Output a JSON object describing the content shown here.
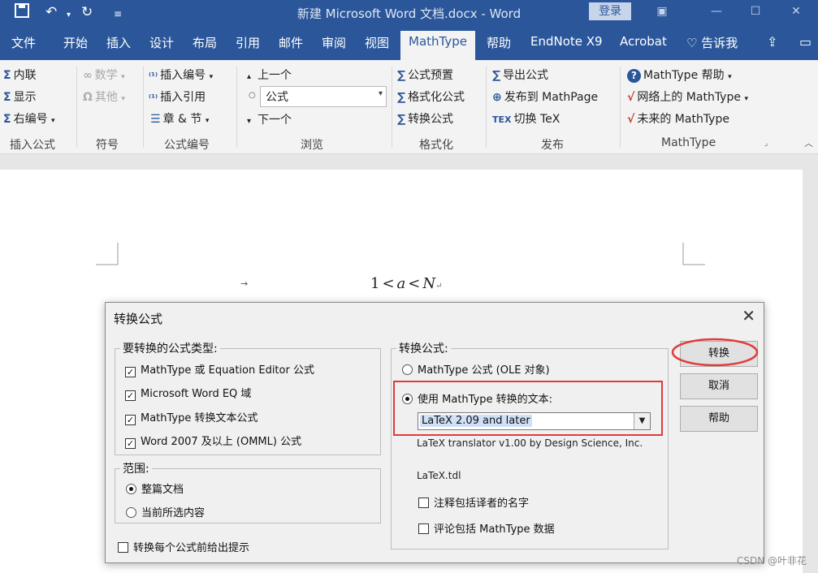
{
  "window": {
    "title": "新建 Microsoft Word 文档.docx  -  Word",
    "login": "登录",
    "qa_icons": [
      "save-icon",
      "undo-icon",
      "redo-icon",
      "customize-icon"
    ],
    "win_controls": [
      "ribbon-display-icon",
      "minimize-icon",
      "maximize-icon",
      "close-icon"
    ]
  },
  "tabs": [
    {
      "label": "文件"
    },
    {
      "label": "开始"
    },
    {
      "label": "插入"
    },
    {
      "label": "设计"
    },
    {
      "label": "布局"
    },
    {
      "label": "引用"
    },
    {
      "label": "邮件"
    },
    {
      "label": "审阅"
    },
    {
      "label": "视图"
    },
    {
      "label": "MathType"
    },
    {
      "label": "帮助"
    },
    {
      "label": "EndNote X9"
    },
    {
      "label": "Acrobat"
    },
    {
      "label": "告诉我"
    }
  ],
  "ribbon": {
    "insert_formula": {
      "inline": "内联",
      "display": "显示",
      "right_numbered": "右编号",
      "label": "插入公式"
    },
    "symbols": {
      "math": "数学",
      "other": "其他",
      "label": "符号"
    },
    "numbering": {
      "insert_number": "插入编号",
      "insert_ref": "插入引用",
      "chapter": "章 & 节",
      "label": "公式编号"
    },
    "browse": {
      "prev": "上一个",
      "combo_value": "公式",
      "next": "下一个",
      "label": "浏览"
    },
    "format": {
      "preset": "公式预置",
      "format_formula": "格式化公式",
      "convert": "转换公式",
      "label": "格式化"
    },
    "publish": {
      "export": "导出公式",
      "mathpage": "发布到 MathPage",
      "tex": "切换 TeX",
      "label": "发布"
    },
    "mathtype": {
      "help": "MathType 帮助",
      "web": "网络上的 MathType",
      "future": "未来的 MathType",
      "label": "MathType"
    }
  },
  "document": {
    "formula": {
      "one": "1",
      "lt1": "<",
      "a": "a",
      "lt2": "<",
      "n": "N"
    },
    "tab_mark": "→",
    "para_mark": "↵"
  },
  "dialog": {
    "title": "转换公式",
    "types_group": "要转换的公式类型:",
    "types": [
      {
        "label": "MathType 或 Equation Editor 公式",
        "checked": true
      },
      {
        "label": "Microsoft Word EQ 域",
        "checked": true
      },
      {
        "label": "MathType 转换文本公式",
        "checked": true
      },
      {
        "label": "Word 2007 及以上 (OMML) 公式",
        "checked": true
      }
    ],
    "scope_group": "范围:",
    "scope": [
      {
        "label": "整篇文档",
        "selected": true
      },
      {
        "label": "当前所选内容",
        "selected": false
      }
    ],
    "prompt_each": "转换每个公式前给出提示",
    "convert_group": "转换公式:",
    "convert_opts": [
      {
        "label": "MathType 公式 (OLE 对象)",
        "selected": false
      },
      {
        "label": "使用 MathType 转换的文本:",
        "selected": true
      }
    ],
    "translator_value": "LaTeX 2.09 and later",
    "translator_desc": "LaTeX translator v1.00 by Design Science, Inc.",
    "translator_file": "LaTeX.tdl",
    "include_name": "注释包括译者的名字",
    "include_data": "评论包括 MathType 数据",
    "buttons": {
      "convert": "转换",
      "cancel": "取消",
      "help": "帮助"
    }
  },
  "watermark": "CSDN @叶非花",
  "colors": {
    "word_blue": "#2b579a",
    "highlight_red": "#e03c3c",
    "selection": "#cfe0f7"
  }
}
